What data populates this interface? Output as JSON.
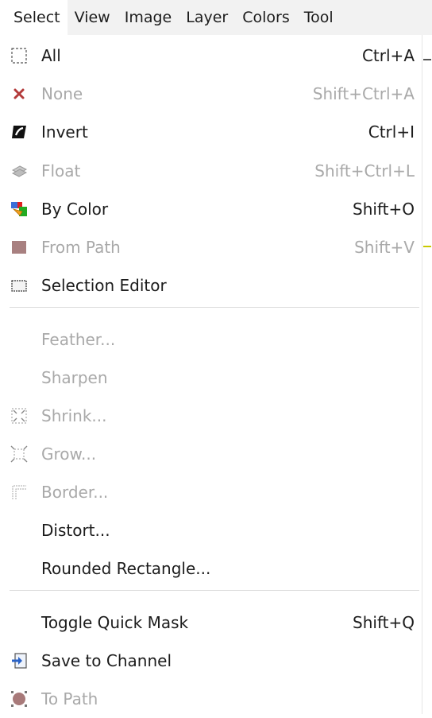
{
  "menubar": {
    "items": [
      "Select",
      "View",
      "Image",
      "Layer",
      "Colors",
      "Tool"
    ]
  },
  "menu": {
    "items": [
      {
        "label": "All",
        "accel": "Ctrl+A",
        "enabled": true,
        "icon": "select-all-icon"
      },
      {
        "label": "None",
        "accel": "Shift+Ctrl+A",
        "enabled": false,
        "icon": "select-none-icon"
      },
      {
        "label": "Invert",
        "accel": "Ctrl+I",
        "enabled": true,
        "icon": "invert-icon"
      },
      {
        "label": "Float",
        "accel": "Shift+Ctrl+L",
        "enabled": false,
        "icon": "float-icon"
      },
      {
        "label": "By Color",
        "accel": "Shift+O",
        "enabled": true,
        "icon": "by-color-icon"
      },
      {
        "label": "From Path",
        "accel": "Shift+V",
        "enabled": false,
        "icon": "from-path-icon"
      },
      {
        "label": "Selection Editor",
        "accel": "",
        "enabled": true,
        "icon": "selection-editor-icon"
      },
      {
        "label": "Feather...",
        "accel": "",
        "enabled": false,
        "icon": ""
      },
      {
        "label": "Sharpen",
        "accel": "",
        "enabled": false,
        "icon": ""
      },
      {
        "label": "Shrink...",
        "accel": "",
        "enabled": false,
        "icon": "shrink-icon"
      },
      {
        "label": "Grow...",
        "accel": "",
        "enabled": false,
        "icon": "grow-icon"
      },
      {
        "label": "Border...",
        "accel": "",
        "enabled": false,
        "icon": "border-icon"
      },
      {
        "label": "Distort...",
        "accel": "",
        "enabled": true,
        "icon": ""
      },
      {
        "label": "Rounded Rectangle...",
        "accel": "",
        "enabled": true,
        "icon": ""
      },
      {
        "label": "Toggle Quick Mask",
        "accel": "Shift+Q",
        "enabled": true,
        "icon": ""
      },
      {
        "label": "Save to Channel",
        "accel": "",
        "enabled": true,
        "icon": "save-to-channel-icon"
      },
      {
        "label": "To Path",
        "accel": "",
        "enabled": false,
        "icon": "to-path-icon"
      }
    ]
  }
}
